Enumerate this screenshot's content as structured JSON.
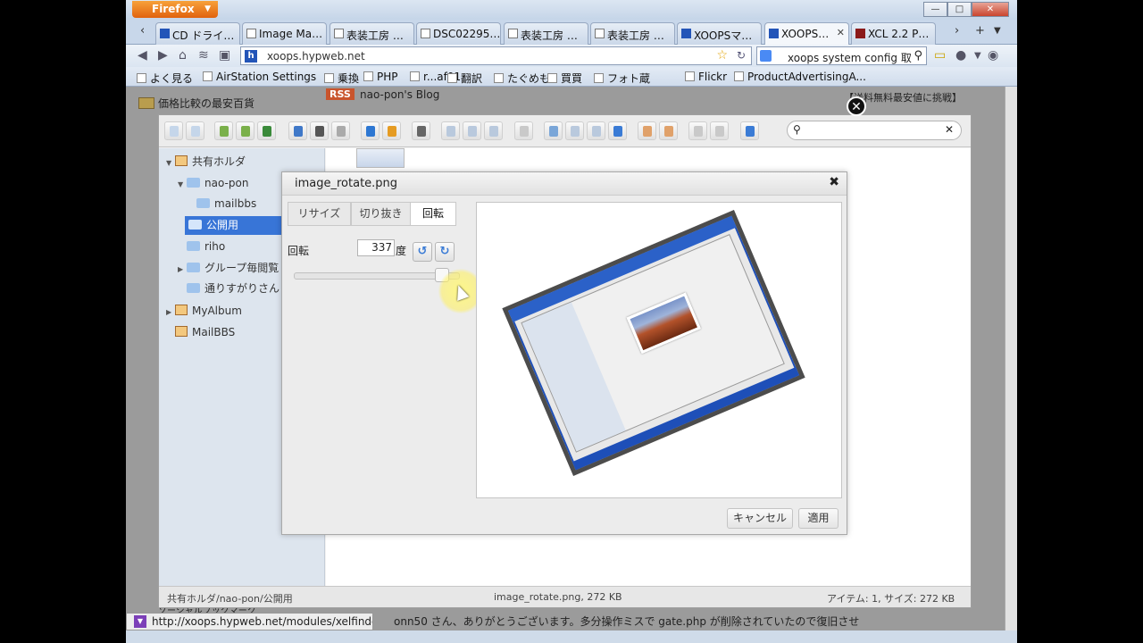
{
  "browser": {
    "menu_button": "Firefox",
    "tabs": [
      {
        "label": "CD ドライ…",
        "icon": "m-icon"
      },
      {
        "label": "Image Ma…",
        "icon": "page-icon"
      },
      {
        "label": "表装工房 …",
        "icon": "page-icon"
      },
      {
        "label": "DSC02295…",
        "icon": "page-icon"
      },
      {
        "label": "表装工房 …",
        "icon": "page-icon"
      },
      {
        "label": "表装工房 …",
        "icon": "page-icon"
      },
      {
        "label": "XOOPSマ…",
        "icon": "h-icon"
      },
      {
        "label": "XOOPS…",
        "icon": "h-icon"
      },
      {
        "label": "XCL 2.2 P…",
        "icon": "x-icon"
      }
    ],
    "url": "xoops.hypweb.net",
    "search_text": "xoops system config 取",
    "bookmarks": [
      "よく見る",
      "AirStation Settings",
      "乗換",
      "PHP",
      "r...af01",
      "翻訳",
      "たぐめも",
      "買買",
      "フォト蔵",
      "Flickr",
      "ProductAdvertisingA..."
    ],
    "status_url": "http://xoops.hypweb.net/modules/xelfinder/#"
  },
  "page_bg": {
    "left_first": "価格比較の最安百貨",
    "rss_label": "RSS",
    "blog_title": "nao-pon's Blog",
    "right_top": "【送料無料最安値に挑戦】",
    "bottom_comment": "onn50 さん、ありがとうございます。多分操作ミスで gate.php が削除されていたので復旧させ",
    "bottom_left": "ソーシャルブックマーク"
  },
  "elfinder": {
    "search_placeholder": "",
    "tree": [
      {
        "label": "共有ホルダ",
        "type": "home",
        "indent": 0
      },
      {
        "label": "nao-pon",
        "type": "folder",
        "indent": 1
      },
      {
        "label": "mailbbs",
        "type": "folder",
        "indent": 2
      },
      {
        "label": "公開用",
        "type": "folder",
        "indent": 2,
        "selected": true
      },
      {
        "label": "riho",
        "type": "folder",
        "indent": 1
      },
      {
        "label": "グループ毎閲覧",
        "type": "folder",
        "indent": 1
      },
      {
        "label": "通りすがりさん",
        "type": "folder",
        "indent": 1
      },
      {
        "label": "MyAlbum",
        "type": "home",
        "indent": 0
      },
      {
        "label": "MailBBS",
        "type": "home",
        "indent": 0
      }
    ],
    "status": {
      "path": "共有ホルダ/nao-pon/公開用",
      "file": "image_rotate.png, 272 KB",
      "summary": "アイテム: 1, サイズ: 272 KB"
    }
  },
  "dialog": {
    "title": "image_rotate.png",
    "tabs": [
      "リサイズ",
      "切り抜き",
      "回転"
    ],
    "active_tab": "回転",
    "rotate_label": "回転",
    "rotate_value": "337",
    "rotate_unit": "度",
    "slider_fraction": 0.936,
    "cancel_label": "キャンセル",
    "apply_label": "適用"
  }
}
